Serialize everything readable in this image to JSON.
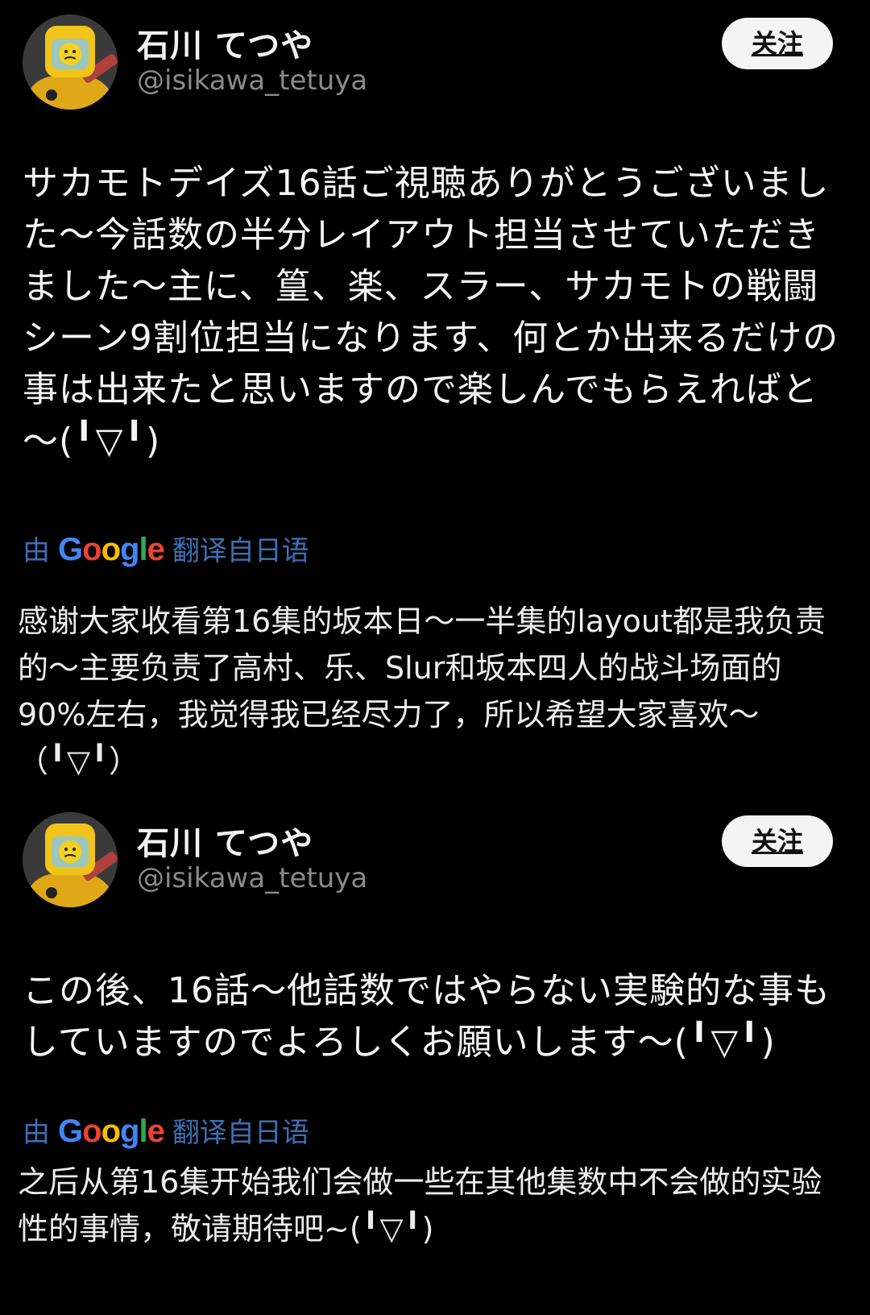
{
  "posts": [
    {
      "author": {
        "display_name": "石川 てつや",
        "handle": "@isikawa_tetuya",
        "avatar_icon": "lego-hazmat-avatar-icon"
      },
      "follow_label": "关注",
      "original_text": "サカモトデイズ16話ご視聴ありがとうございました～今話数の半分レイアウト担当させていただきました～主に、篁、楽、スラー、サカモトの戦闘シーン9割位担当になります、何とか出来るだけの事は出来たと思いますので楽しんでもらえればと～(╹▽╹)",
      "translation": {
        "prefix": "由",
        "logo": "Google",
        "suffix": "翻译自日语",
        "text": "感谢大家收看第16集的坂本日～一半集的layout都是我负责的～主要负责了高村、乐、Slur和坂本四人的战斗场面的90%左右，我觉得我已经尽力了，所以希望大家喜欢～（╹▽╹）"
      }
    },
    {
      "author": {
        "display_name": "石川 てつや",
        "handle": "@isikawa_tetuya",
        "avatar_icon": "lego-hazmat-avatar-icon"
      },
      "follow_label": "关注",
      "original_text": "この後、16話～他話数ではやらない実験的な事もしていますのでよろしくお願いします～(╹▽╹)",
      "translation": {
        "prefix": "由",
        "logo": "Google",
        "suffix": "翻译自日语",
        "text": "之后从第16集开始我们会做一些在其他集数中不会做的实验性的事情，敬请期待吧~(╹▽╹)"
      }
    }
  ],
  "colors": {
    "background": "#000000",
    "translate_blue": "#3d6fb5",
    "handle_gray": "#8a8a8a",
    "button_bg": "#f4f4f4"
  }
}
